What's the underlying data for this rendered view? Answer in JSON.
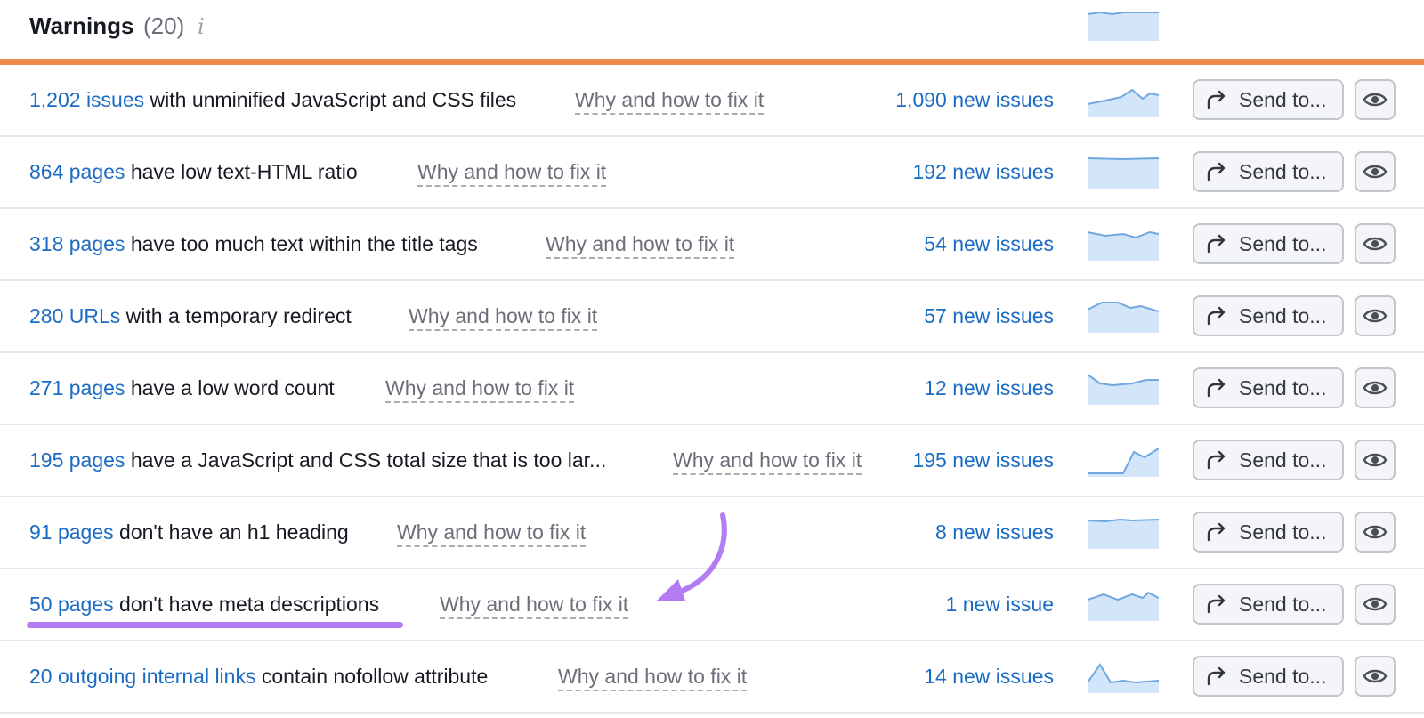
{
  "header": {
    "title": "Warnings",
    "count": "(20)",
    "info_icon": "info-icon"
  },
  "colors": {
    "accent_orange": "#ec8b4a",
    "link_blue": "#1a6bc4",
    "spark_fill": "#d3e5f8",
    "spark_line": "#6fa8e0",
    "annotation_purple": "#b47cf2"
  },
  "rows": [
    {
      "count_link": "1,202 issues",
      "description": " with unminified JavaScript and CSS files",
      "fix_link": "Why and how to fix it",
      "new_issues": "1,090 new issues",
      "send_label": "Send to...",
      "send_icon": "share-arrow-icon",
      "eye_icon": "eye-icon"
    },
    {
      "count_link": "864 pages",
      "description": " have low text-HTML ratio",
      "fix_link": "Why and how to fix it",
      "new_issues": "192 new issues",
      "send_label": "Send to...",
      "send_icon": "share-arrow-icon",
      "eye_icon": "eye-icon"
    },
    {
      "count_link": "318 pages",
      "description": " have too much text within the title tags",
      "fix_link": "Why and how to fix it",
      "new_issues": "54 new issues",
      "send_label": "Send to...",
      "send_icon": "share-arrow-icon",
      "eye_icon": "eye-icon"
    },
    {
      "count_link": "280 URLs",
      "description": " with a temporary redirect",
      "fix_link": "Why and how to fix it",
      "new_issues": "57 new issues",
      "send_label": "Send to...",
      "send_icon": "share-arrow-icon",
      "eye_icon": "eye-icon"
    },
    {
      "count_link": "271 pages",
      "description": " have a low word count",
      "fix_link": "Why and how to fix it",
      "new_issues": "12 new issues",
      "send_label": "Send to...",
      "send_icon": "share-arrow-icon",
      "eye_icon": "eye-icon"
    },
    {
      "count_link": "195 pages",
      "description": " have a JavaScript and CSS total size that is too lar...",
      "fix_link": "Why and how to fix it",
      "new_issues": "195 new issues",
      "send_label": "Send to...",
      "send_icon": "share-arrow-icon",
      "eye_icon": "eye-icon"
    },
    {
      "count_link": "91 pages",
      "description": " don't have an h1 heading",
      "fix_link": "Why and how to fix it",
      "new_issues": "8 new issues",
      "send_label": "Send to...",
      "send_icon": "share-arrow-icon",
      "eye_icon": "eye-icon"
    },
    {
      "count_link": "50 pages",
      "description": " don't have meta descriptions",
      "fix_link": "Why and how to fix it",
      "new_issues": "1 new issue",
      "send_label": "Send to...",
      "send_icon": "share-arrow-icon",
      "eye_icon": "eye-icon"
    },
    {
      "count_link": "20 outgoing internal links",
      "description": " contain nofollow attribute",
      "fix_link": "Why and how to fix it",
      "new_issues": "14 new issues",
      "send_label": "Send to...",
      "send_icon": "share-arrow-icon",
      "eye_icon": "eye-icon"
    }
  ]
}
